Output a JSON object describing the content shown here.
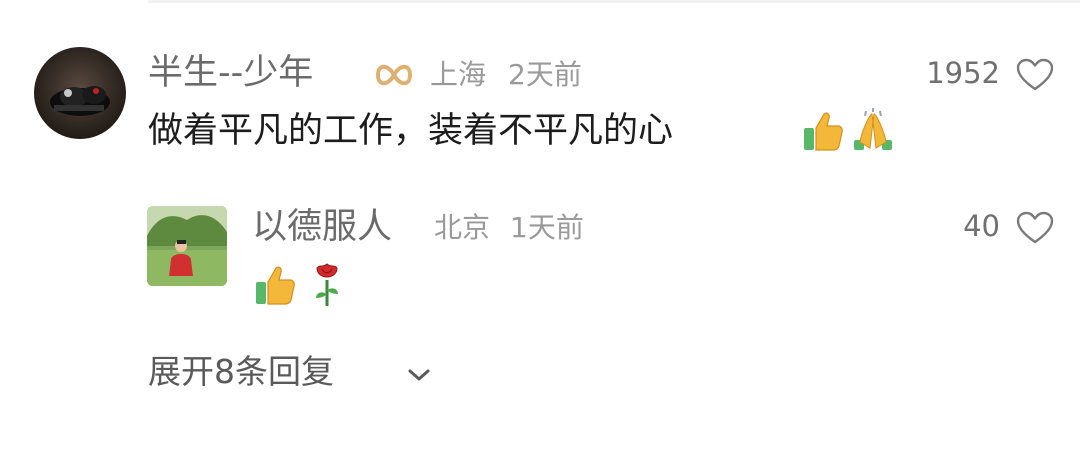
{
  "comments": [
    {
      "username": "半生--少年",
      "location": "上海",
      "time": "2天前",
      "likes": "1952",
      "text": "做着平凡的工作，装着不平凡的心",
      "emojis": [
        "thumbs-up",
        "folded-hands"
      ]
    }
  ],
  "reply": {
    "username": "以德服人",
    "location": "北京",
    "time": "1天前",
    "likes": "40",
    "emojis": [
      "thumbs-up",
      "rose"
    ]
  },
  "expand": {
    "label": "展开8条回复"
  },
  "colors": {
    "name": "#6b6b6b",
    "meta": "#9a9a9a",
    "text": "#1d1d1d",
    "badge_gold": "#e0b070"
  }
}
